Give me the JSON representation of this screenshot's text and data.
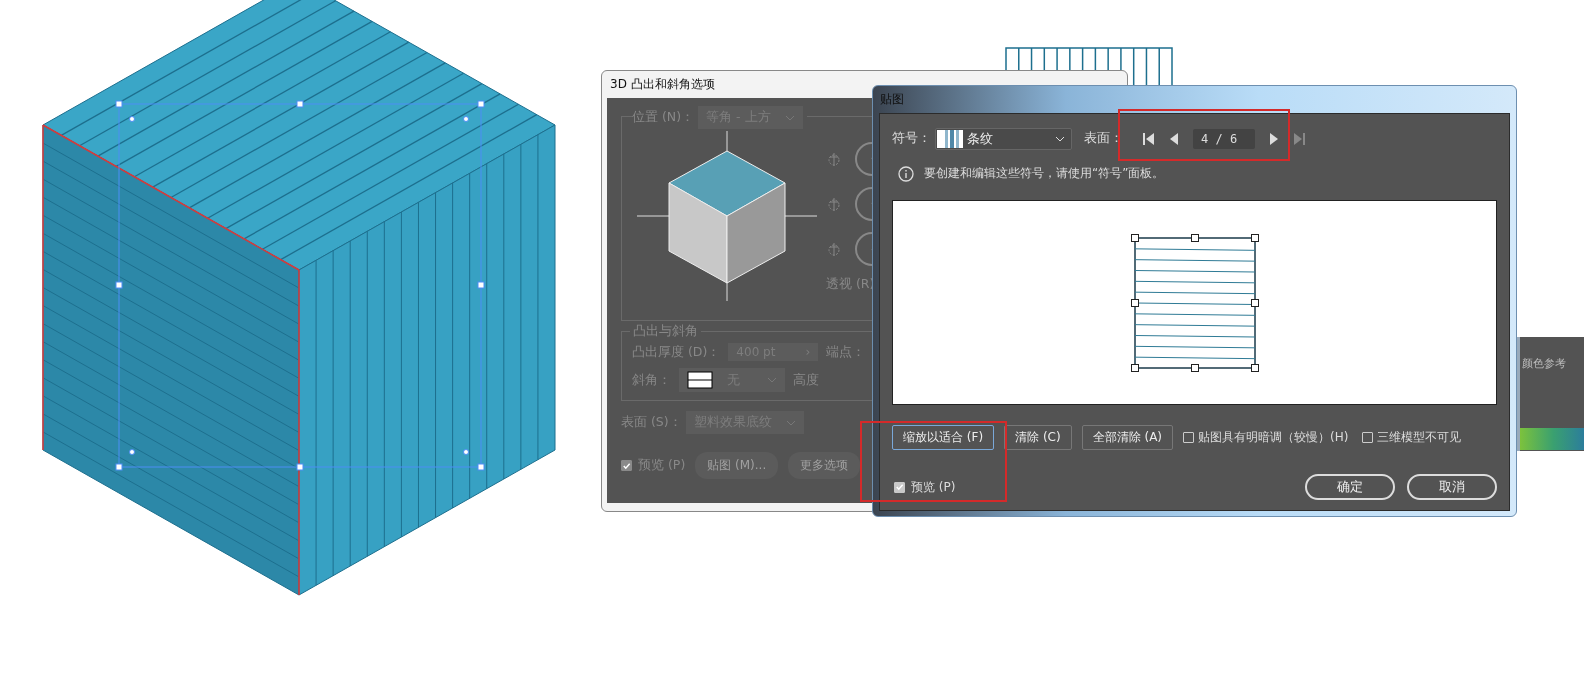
{
  "back_dialog": {
    "title": "3D 凸出和斜角选项",
    "disabled": true,
    "position": {
      "label": "位置 (N)：",
      "value": "等角 - 上方"
    },
    "perspective_label": "透视 (R)",
    "extrude_section": {
      "title": "凸出与斜角",
      "depth_label": "凸出厚度 (D)：",
      "depth_value": "400 pt",
      "depth_stepper": "›",
      "cap_label": "端点：",
      "bevel_label": "斜角：",
      "bevel_value": "无",
      "height_label": "高度"
    },
    "surface": {
      "label": "表面 (S)：",
      "value": "塑料效果底纹"
    },
    "preview": {
      "label": "预览 (P)",
      "checked": true
    },
    "buttons": [
      "贴图 (M)...",
      "更多选项"
    ]
  },
  "map_dialog": {
    "title": "贴图",
    "symbol": {
      "label": "符号：",
      "value": "条纹"
    },
    "surface": {
      "label": "表面：",
      "value": "4 / 6"
    },
    "info": "要创建和编辑这些符号，请使用“符号”面板。",
    "buttons": [
      {
        "label": "缩放以适合 (F)",
        "focused": true
      },
      {
        "label": "清除 (C)",
        "focused": false
      },
      {
        "label": "全部清除 (A)",
        "focused": false
      }
    ],
    "options": [
      {
        "label": "贴图具有明暗调（较慢）(H)",
        "checked": false
      },
      {
        "label": "三维模型不可见",
        "checked": false
      }
    ],
    "preview": {
      "label": "预览 (P)",
      "checked": true
    },
    "ok": "确定",
    "cancel": "取消"
  },
  "side_panel": {
    "title": "颜色参考"
  }
}
